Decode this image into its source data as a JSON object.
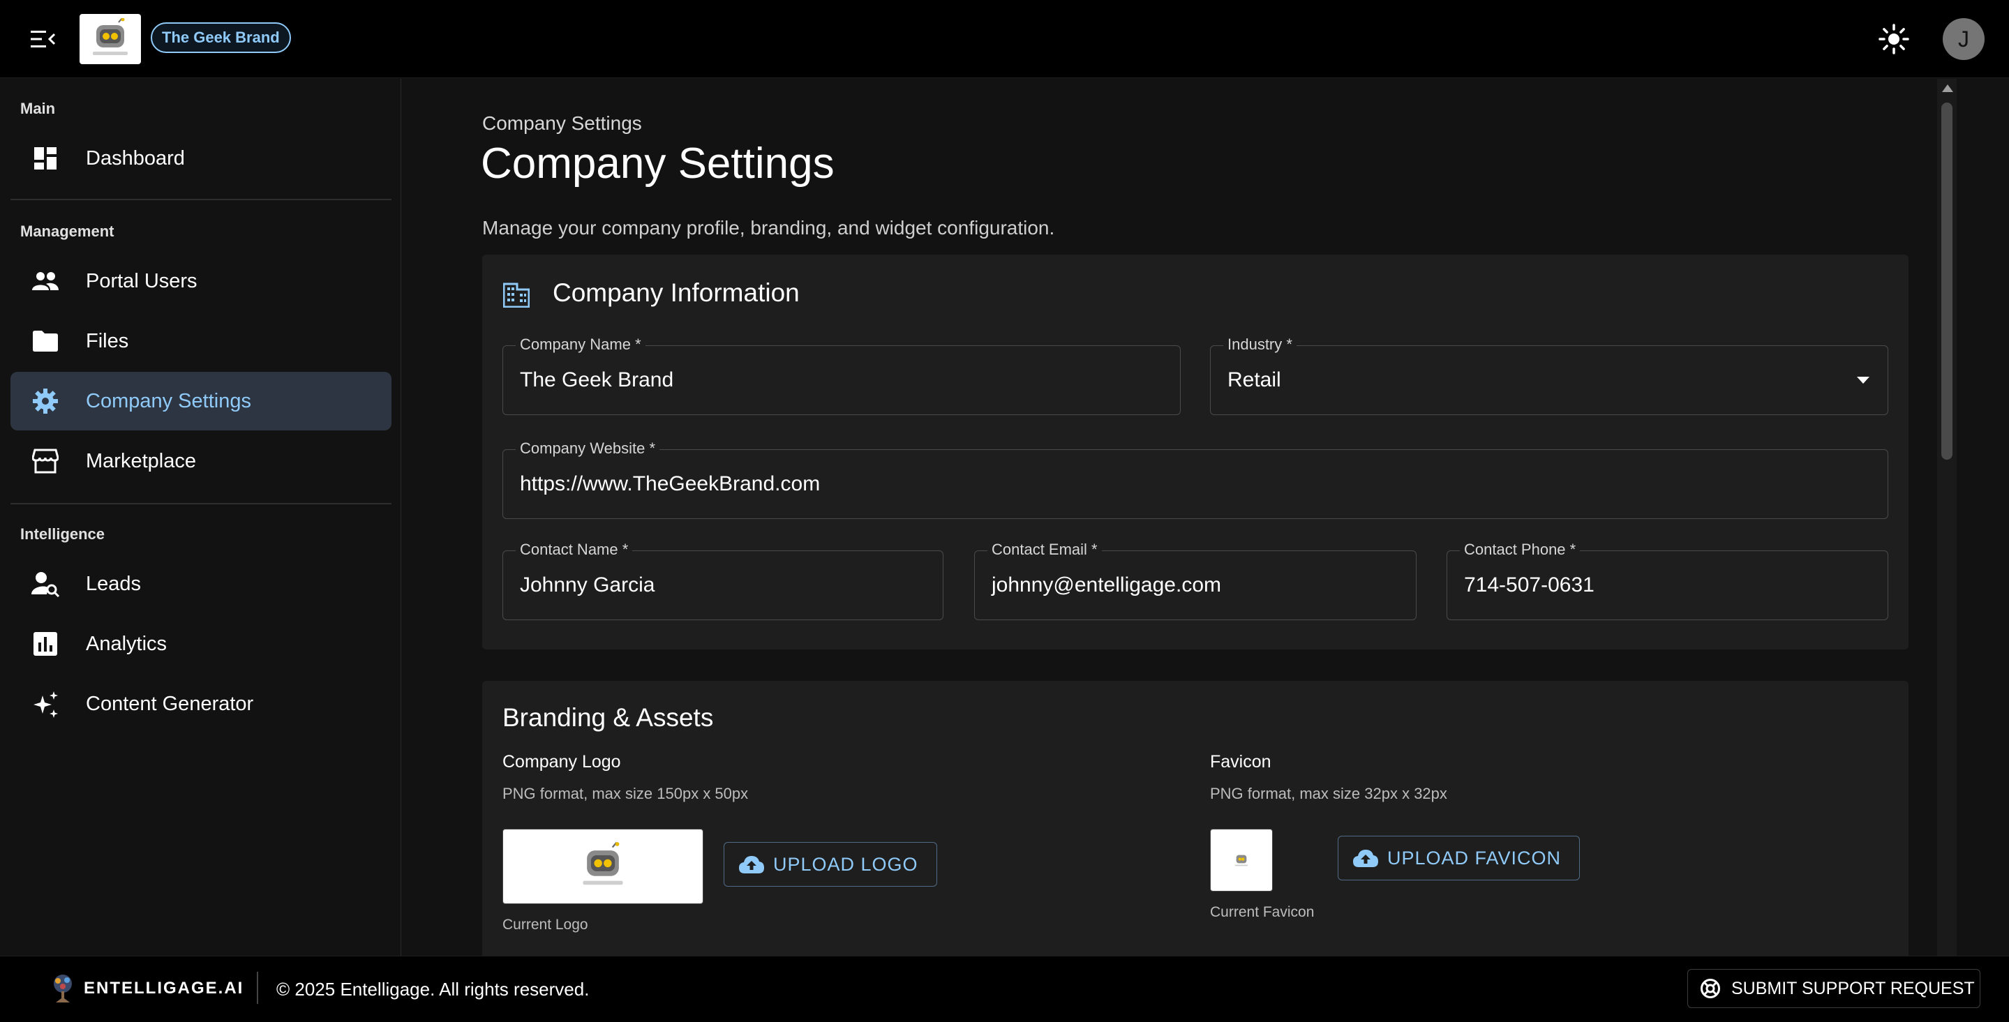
{
  "topbar": {
    "brand_chip": "The Geek Brand",
    "avatar_initial": "J"
  },
  "sidebar": {
    "sections": [
      {
        "label": "Main"
      },
      {
        "label": "Management"
      },
      {
        "label": "Intelligence"
      }
    ],
    "items": [
      {
        "label": "Dashboard",
        "icon": "dashboard-icon"
      },
      {
        "label": "Portal Users",
        "icon": "people-icon"
      },
      {
        "label": "Files",
        "icon": "folder-icon"
      },
      {
        "label": "Company Settings",
        "icon": "gear-icon",
        "active": true
      },
      {
        "label": "Marketplace",
        "icon": "storefront-icon"
      },
      {
        "label": "Leads",
        "icon": "person-search-icon"
      },
      {
        "label": "Analytics",
        "icon": "bar-chart-icon"
      },
      {
        "label": "Content Generator",
        "icon": "sparkle-icon"
      }
    ]
  },
  "main": {
    "breadcrumb": "Company Settings",
    "title": "Company Settings",
    "subtitle": "Manage your company profile, branding, and widget configuration."
  },
  "company_info": {
    "title": "Company Information",
    "company_name": {
      "label": "Company Name *",
      "value": "The Geek Brand"
    },
    "industry": {
      "label": "Industry *",
      "value": "Retail"
    },
    "website": {
      "label": "Company Website *",
      "value": "https://www.TheGeekBrand.com"
    },
    "contact_name": {
      "label": "Contact Name *",
      "value": "Johnny Garcia"
    },
    "contact_email": {
      "label": "Contact Email *",
      "value": "johnny@entelligage.com"
    },
    "contact_phone": {
      "label": "Contact Phone *",
      "value": "714-507-0631"
    }
  },
  "branding": {
    "title": "Branding & Assets",
    "logo": {
      "label": "Company Logo",
      "hint": "PNG format, max size 150px x 50px",
      "caption": "Current Logo",
      "button": "UPLOAD LOGO"
    },
    "favicon": {
      "label": "Favicon",
      "hint": "PNG format, max size 32px x 32px",
      "caption": "Current Favicon",
      "button": "UPLOAD FAVICON"
    }
  },
  "footer": {
    "brand": "ENTELLIGAGE.AI",
    "copyright": "© 2025 Entelligage. All rights reserved.",
    "support_button": "SUBMIT SUPPORT REQUEST"
  },
  "colors": {
    "accent": "#90caf9",
    "background": "#121212",
    "card": "#1e1e1e",
    "active_item": "#2c3541"
  }
}
